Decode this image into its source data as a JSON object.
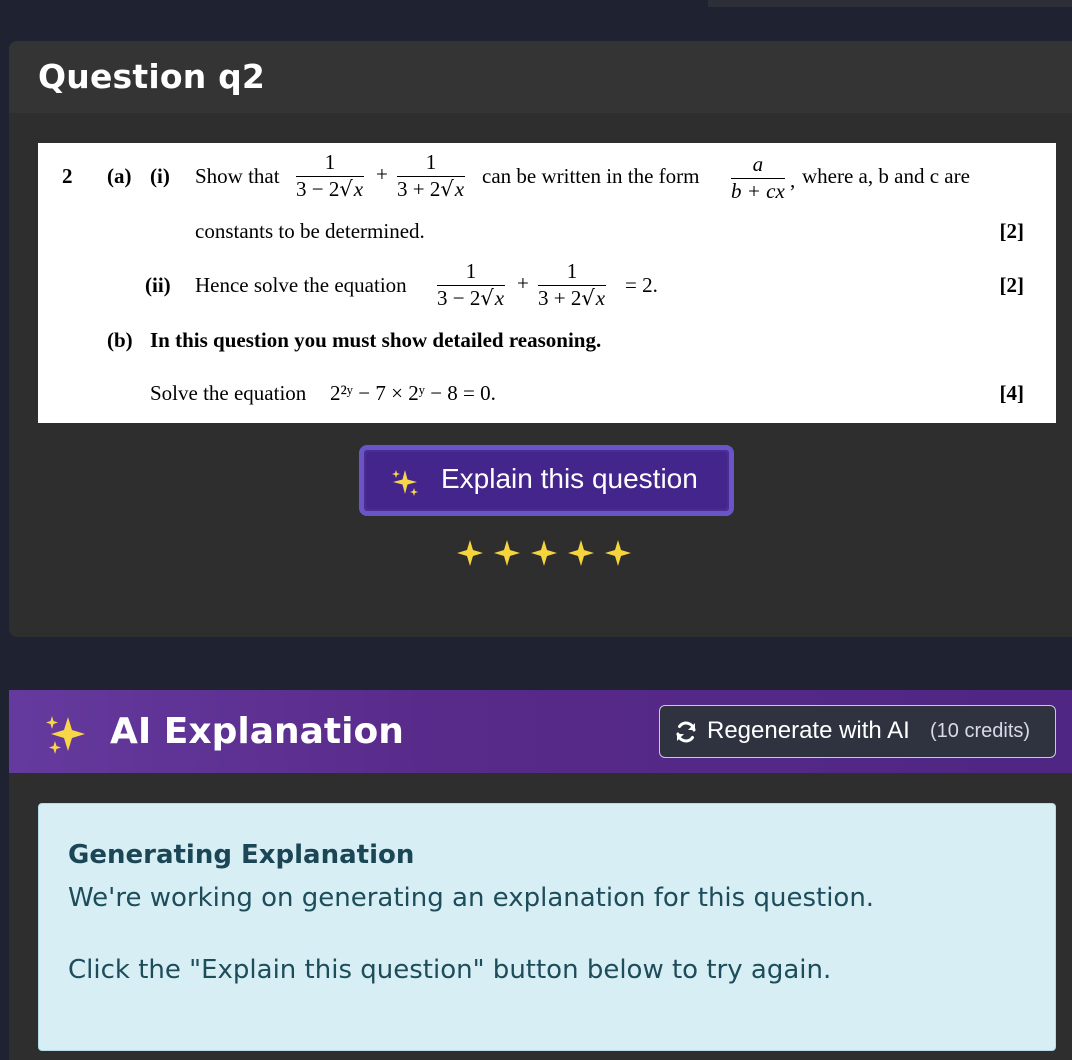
{
  "question": {
    "title": "Question q2",
    "paper": {
      "number": "2",
      "part_a": "(a)",
      "sub_i": "(i)",
      "show_that": "Show that",
      "frac1_num": "1",
      "frac1_den_a": "3 − 2",
      "frac1_den_x": "x",
      "plus": "+",
      "frac2_num": "1",
      "frac2_den_a": "3 + 2",
      "frac2_den_x": "x",
      "can_be_written": "can be written in the form",
      "form_num": "a",
      "form_den": "b + cx",
      "comma": ",",
      "where_text": "where a, b and c are",
      "constants_text": "constants to be determined.",
      "marks_i": "[2]",
      "sub_ii": "(ii)",
      "hence_text": "Hence solve the equation",
      "equals_2": "= 2.",
      "marks_ii": "[2]",
      "part_b": "(b)",
      "b_heading": "In this question you must show detailed reasoning.",
      "solve_text": "Solve the equation",
      "equation_b": "2²ʸ − 7 × 2ʸ − 8 = 0.",
      "marks_b": "[4]"
    },
    "explain_button_label": "Explain this question",
    "sparkle_count": 5
  },
  "ai_explanation": {
    "title": "AI Explanation",
    "regenerate_label": "Regenerate with AI",
    "regenerate_credits": "(10 credits)",
    "status_heading": "Generating Explanation",
    "status_message": "We're working on generating an explanation for this question.",
    "retry_message": "Click the \"Explain this question\" button below to try again."
  },
  "colors": {
    "page_bg": "#1e2231",
    "card_bg": "#2e2e2e",
    "button_purple": "#43258c",
    "header_purple": "#582a8a",
    "alert_bg": "#d8eef5",
    "sparkle": "#f5d43c"
  },
  "icons": {
    "explain_button": "sparkles-icon",
    "ai_header": "sparkles-icon",
    "regenerate": "refresh-icon",
    "decor": "sparkle-icon"
  }
}
